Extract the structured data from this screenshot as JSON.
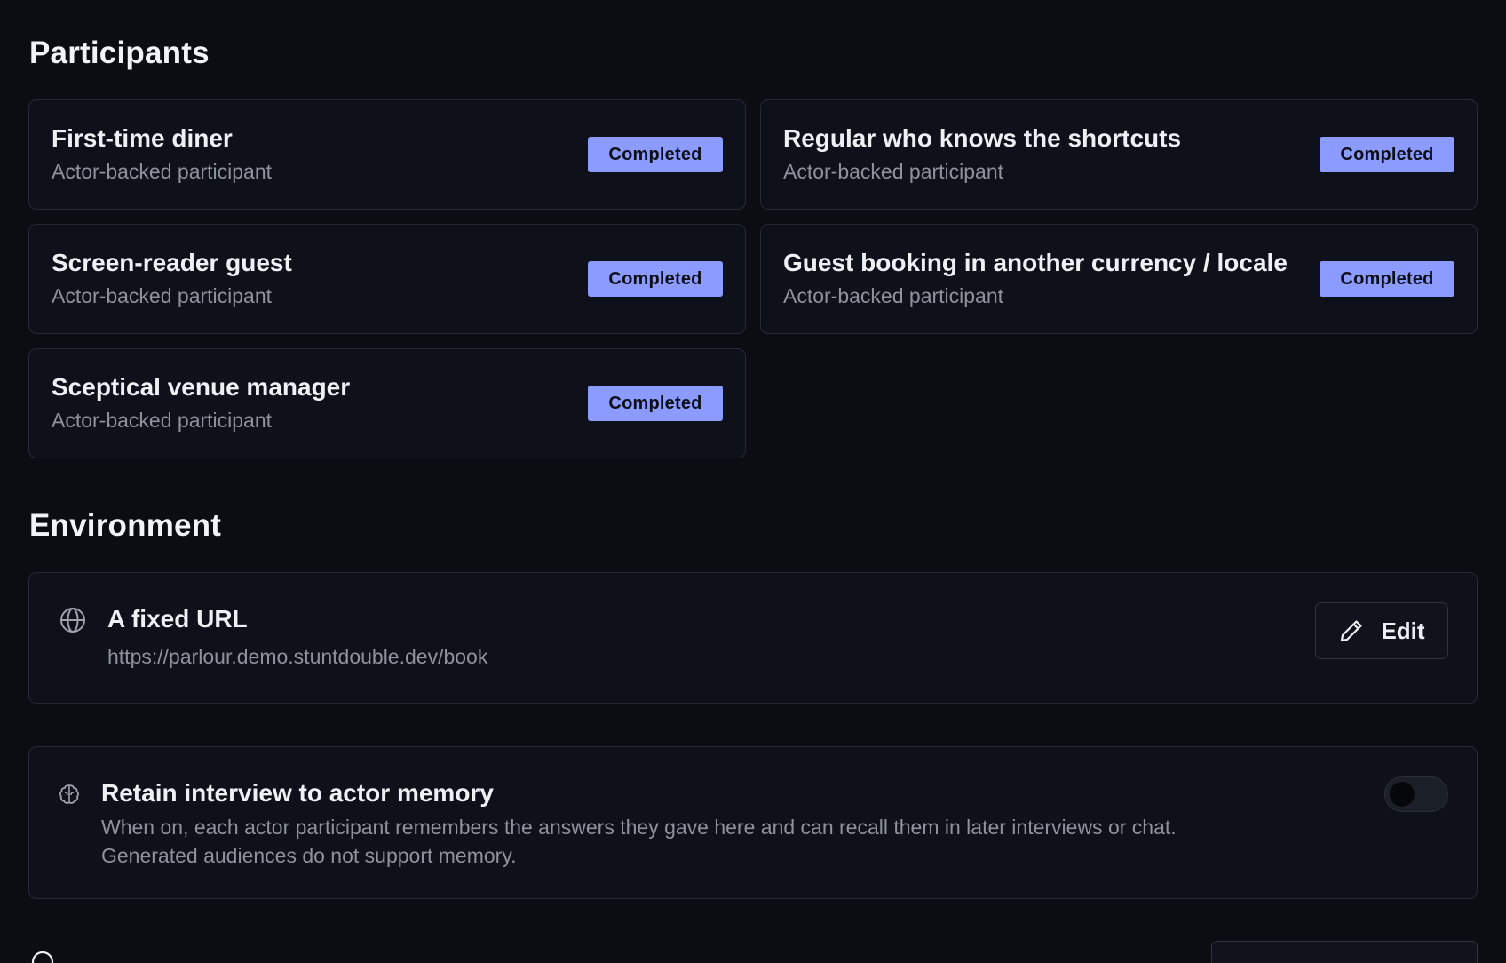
{
  "participants": {
    "title": "Participants",
    "items": [
      {
        "name": "First-time diner",
        "subtitle": "Actor-backed participant",
        "status": "Completed"
      },
      {
        "name": "Regular who knows the shortcuts",
        "subtitle": "Actor-backed participant",
        "status": "Completed"
      },
      {
        "name": "Screen-reader guest",
        "subtitle": "Actor-backed participant",
        "status": "Completed"
      },
      {
        "name": "Guest booking in another currency / locale",
        "subtitle": "Actor-backed participant",
        "status": "Completed"
      },
      {
        "name": "Sceptical venue manager",
        "subtitle": "Actor-backed participant",
        "status": "Completed"
      }
    ]
  },
  "environment": {
    "title": "Environment",
    "card_title": "A fixed URL",
    "url": "https://parlour.demo.stuntdouble.dev/book",
    "edit_label": "Edit",
    "icon": "globe-icon"
  },
  "memory": {
    "title": "Retain interview to actor memory",
    "description_line1": "When on, each actor participant remembers the answers they gave here and can recall them in later interviews or chat.",
    "description_line2": "Generated audiences do not support memory.",
    "enabled": false,
    "icon": "brain-icon"
  },
  "colors": {
    "background": "#0b0d12",
    "card": "#0e1119",
    "badge": "#8c9bff",
    "muted_text": "#8d929c"
  }
}
